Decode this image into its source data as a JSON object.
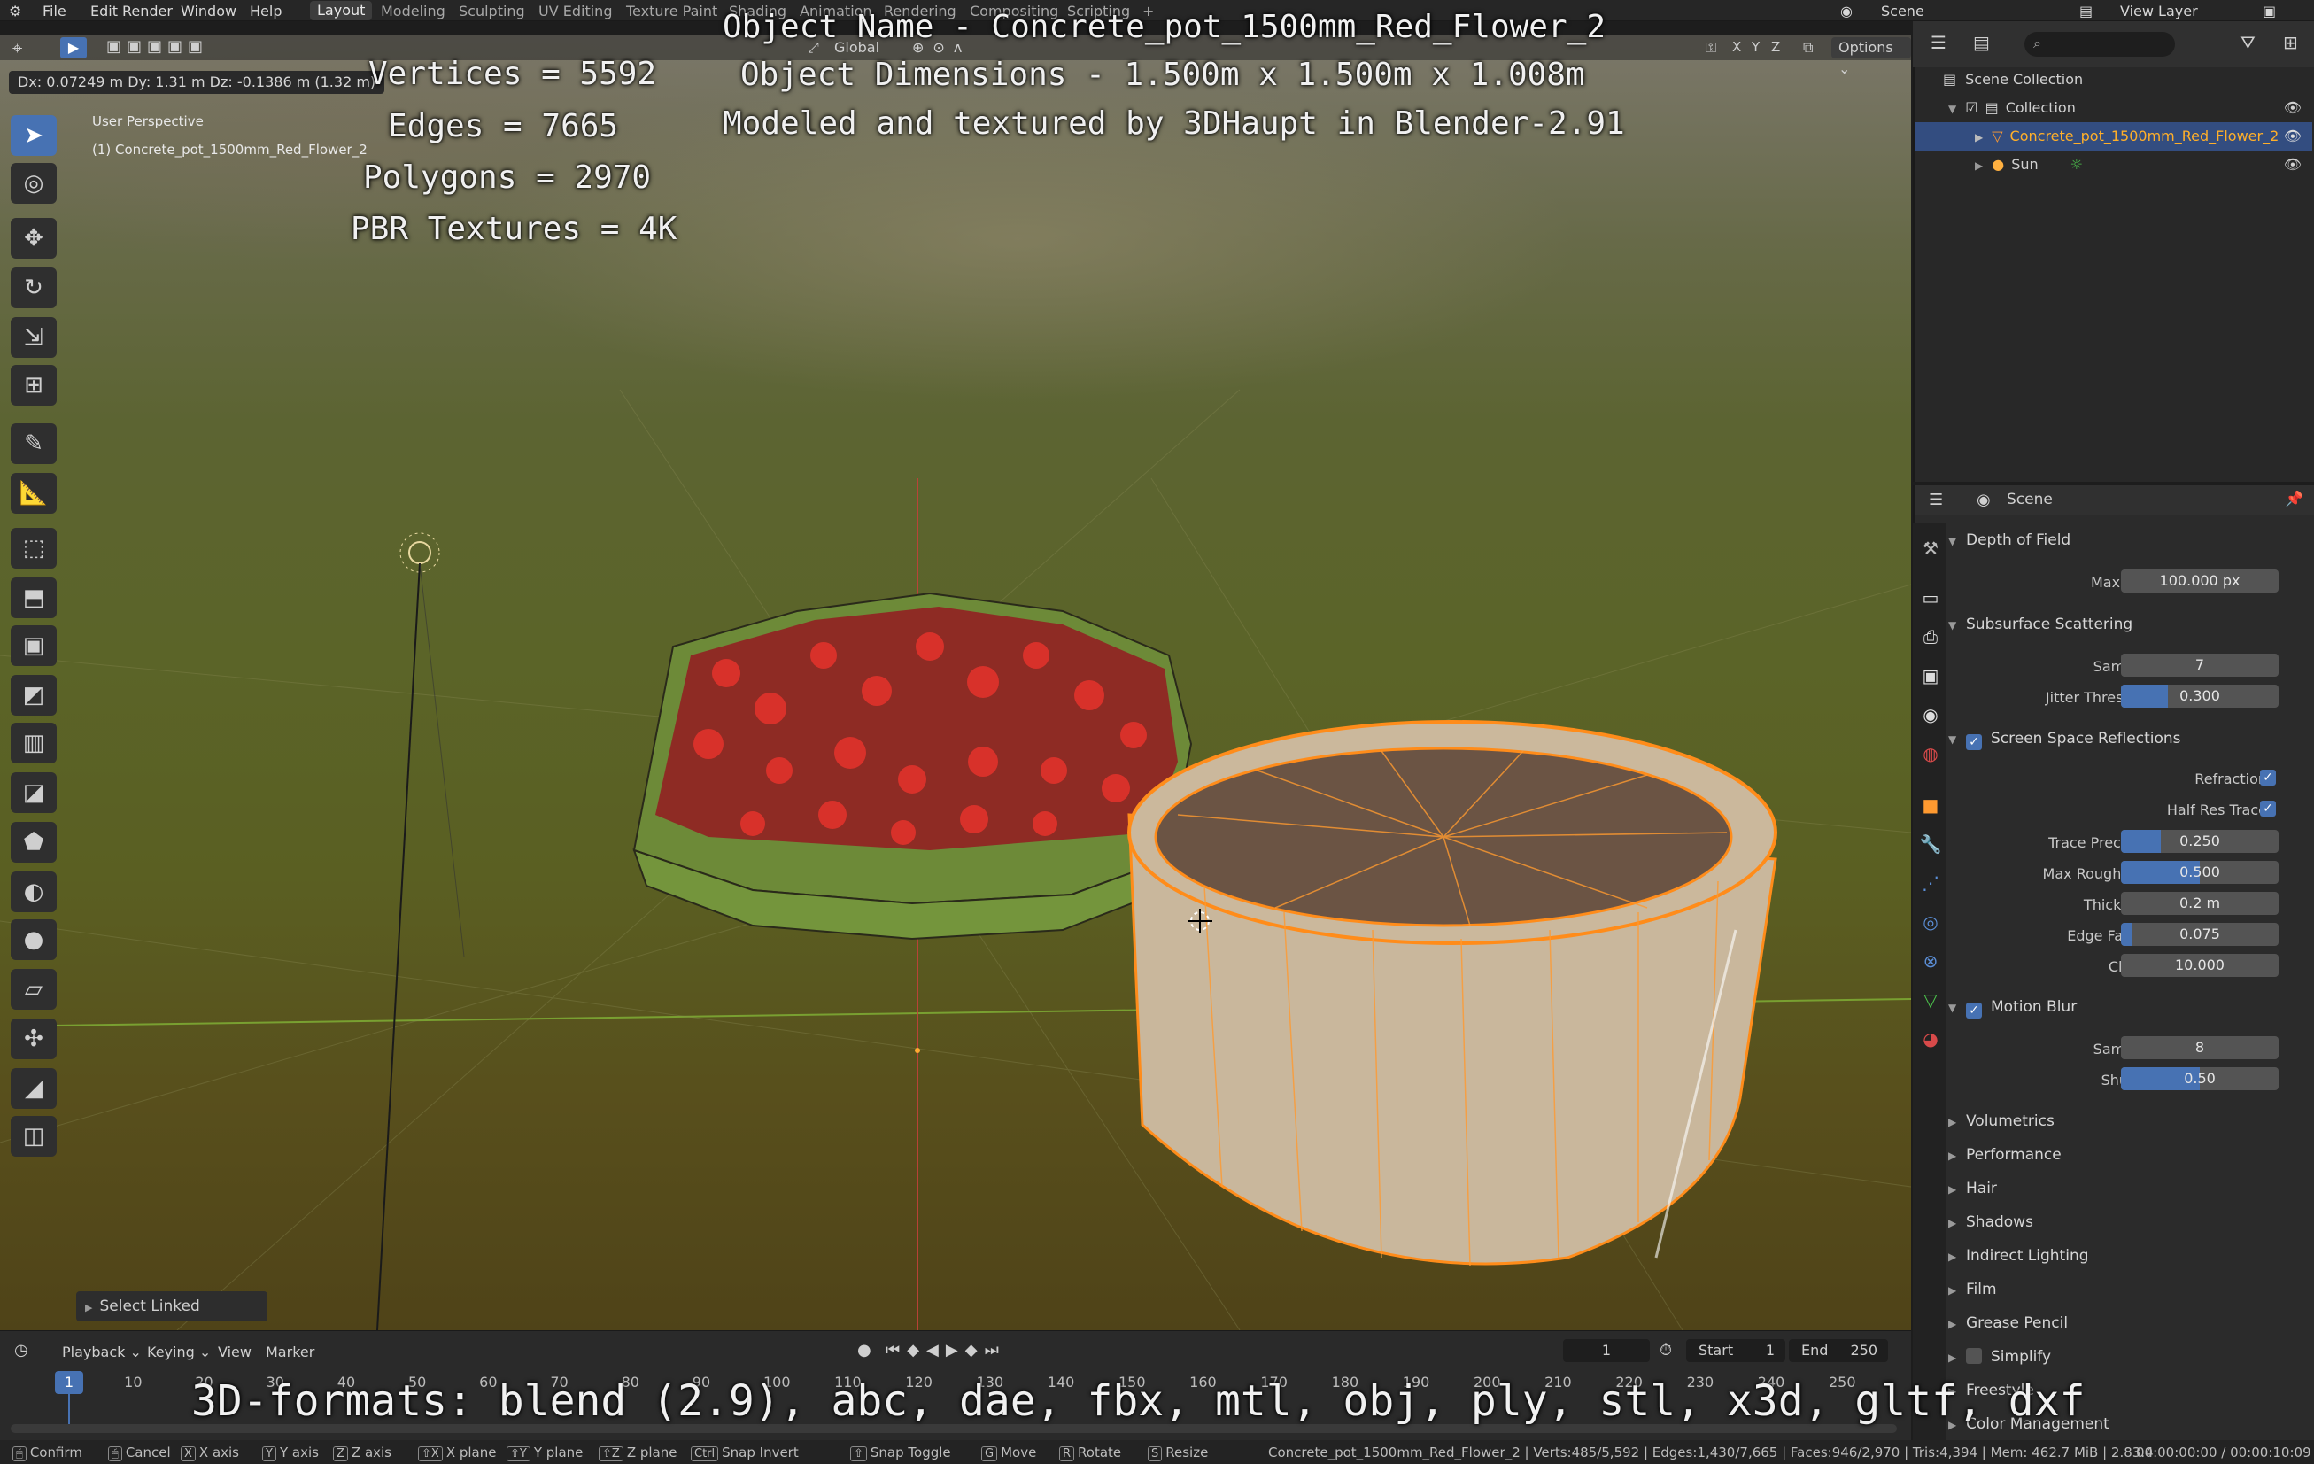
{
  "menubar": {
    "items": [
      "File",
      "Edit",
      "Render",
      "Window",
      "Help"
    ],
    "workspaces": [
      "Layout",
      "Modeling",
      "Sculpting",
      "UV Editing",
      "Texture Paint",
      "Shading",
      "Animation",
      "Rendering",
      "Compositing",
      "Scripting"
    ],
    "active_workspace": "Layout",
    "scene_label": "Scene",
    "view_layer_label": "View Layer"
  },
  "viewport": {
    "transform_info": "Dx: 0.07249 m  Dy: 1.31 m  Dz: -0.1386 m (1.32 m)",
    "perspective_label": "User Perspective",
    "object_label": "(1) Concrete_pot_1500mm_Red_Flower_2",
    "orientation": "Global",
    "options_label": "Options",
    "axes": [
      "X",
      "Y",
      "Z"
    ],
    "select_linked": "Select Linked"
  },
  "overlay": {
    "title_lines": [
      "Object Name - Concrete_pot_1500mm_Red_Flower_2",
      "Object Dimensions -  1.500m x 1.500m x 1.008m",
      "Modeled and textured by 3DHaupt in Blender-2.91"
    ],
    "stats": [
      "Vertices = 5592",
      "Edges = 7665",
      "Polygons = 2970",
      "PBR Textures = 4K"
    ],
    "formats": "3D-formats: blend (2.9), abc, dae, fbx, mtl, obj, ply, stl, x3d, gltf, dxf"
  },
  "outliner": {
    "search_placeholder": "",
    "items": [
      {
        "label": "Scene Collection"
      },
      {
        "label": "Collection"
      },
      {
        "label": "Concrete_pot_1500mm_Red_Flower_2"
      },
      {
        "label": "Sun"
      }
    ]
  },
  "properties": {
    "context": "Scene",
    "sections": {
      "dof": "Depth of Field",
      "sss": "Subsurface Scattering",
      "ssr": "Screen Space Reflections",
      "mblur": "Motion Blur"
    },
    "fields": {
      "max_size": {
        "label": "Max Size",
        "value": "100.000 px"
      },
      "sss_samples": {
        "label": "Samples",
        "value": "7"
      },
      "jitter": {
        "label": "Jitter Threshold",
        "value": "0.300",
        "fraction": 0.3
      },
      "refraction": {
        "label": "Refraction"
      },
      "half_res": {
        "label": "Half Res Trace"
      },
      "trace_precision": {
        "label": "Trace Precision",
        "value": "0.250",
        "fraction": 0.25
      },
      "max_roughness": {
        "label": "Max Roughness",
        "value": "0.500",
        "fraction": 0.5
      },
      "thickness": {
        "label": "Thickness",
        "value": "0.2 m"
      },
      "edge_fading": {
        "label": "Edge Fading",
        "value": "0.075",
        "fraction": 0.075
      },
      "clamp": {
        "label": "Clamp",
        "value": "10.000"
      },
      "mb_samples": {
        "label": "Samples",
        "value": "8"
      },
      "shutter": {
        "label": "Shutter",
        "value": "0.50",
        "fraction": 0.5
      }
    },
    "collapsed": [
      "Volumetrics",
      "Performance",
      "Hair",
      "Shadows",
      "Indirect Lighting",
      "Film",
      "Grease Pencil",
      "Simplify",
      "Freestyle",
      "Color Management"
    ]
  },
  "timeline": {
    "menus": [
      "Playback",
      "Keying",
      "View",
      "Marker"
    ],
    "current_frame": "1",
    "start_label": "Start",
    "start": "1",
    "end_label": "End",
    "end": "250",
    "ruler": [
      "1",
      "10",
      "20",
      "30",
      "40",
      "50",
      "60",
      "70",
      "80",
      "90",
      "100",
      "110",
      "120",
      "130",
      "140",
      "150",
      "160",
      "170",
      "180",
      "190",
      "200",
      "210",
      "220",
      "230",
      "240",
      "250"
    ]
  },
  "statusbar": {
    "hints": [
      {
        "key": "",
        "label": "Confirm"
      },
      {
        "key": "",
        "label": "Cancel"
      },
      {
        "key": "X",
        "label": "X axis"
      },
      {
        "key": "Y",
        "label": "Y axis"
      },
      {
        "key": "Z",
        "label": "Z axis"
      },
      {
        "key": "⇧X",
        "label": "X plane"
      },
      {
        "key": "⇧Y",
        "label": "Y plane"
      },
      {
        "key": "⇧Z",
        "label": "Z plane"
      },
      {
        "key": "Ctrl",
        "label": "Snap Invert"
      },
      {
        "key": "⇧",
        "label": "Snap Toggle"
      },
      {
        "key": "G",
        "label": "Move"
      },
      {
        "key": "R",
        "label": "Rotate"
      },
      {
        "key": "S",
        "label": "Resize"
      }
    ],
    "info": "Concrete_pot_1500mm_Red_Flower_2 | Verts:485/5,592 | Edges:1,430/7,665 | Faces:946/2,970 | Tris:4,394 | Mem: 462.7 MiB | 2.83.4",
    "timecode": "00:00:00:00 / 00:00:10:09"
  }
}
